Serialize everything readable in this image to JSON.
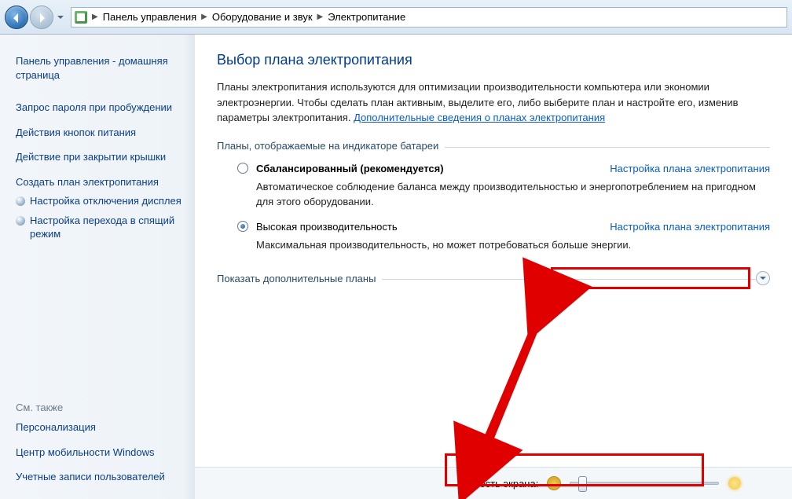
{
  "breadcrumb": {
    "root": "Панель управления",
    "level1": "Оборудование и звук",
    "level2": "Электропитание"
  },
  "sidebar": {
    "home": "Панель управления - домашняя страница",
    "items": [
      "Запрос пароля при пробуждении",
      "Действия кнопок питания",
      "Действие при закрытии крышки",
      "Создать план электропитания",
      "Настройка отключения дисплея",
      "Настройка перехода в спящий режим"
    ],
    "see_also_hdr": "См. также",
    "see_also": [
      "Персонализация",
      "Центр мобильности Windows",
      "Учетные записи пользователей"
    ]
  },
  "content": {
    "title": "Выбор плана электропитания",
    "desc1": "Планы электропитания используются для оптимизации производительности компьютера или экономии электроэнергии. Чтобы сделать план активным, выделите его, либо выберите план и настройте его, изменив параметры электропитания. ",
    "desc_link": "Дополнительные сведения о планах электропитания",
    "group_label": "Планы, отображаемые на индикаторе батареи",
    "plan1": {
      "name": "Сбалансированный (рекомендуется)",
      "link": "Настройка плана электропитания",
      "desc": "Автоматическое соблюдение баланса между производительностью и энергопотреблением на пригодном для этого оборудовании."
    },
    "plan2": {
      "name": "Высокая производительность",
      "link": "Настройка плана электропитания",
      "desc": "Максимальная производительность, но может потребоваться больше энергии."
    },
    "more_label": "Показать дополнительные планы"
  },
  "bottom": {
    "brightness_label": "Яркость экрана:"
  }
}
